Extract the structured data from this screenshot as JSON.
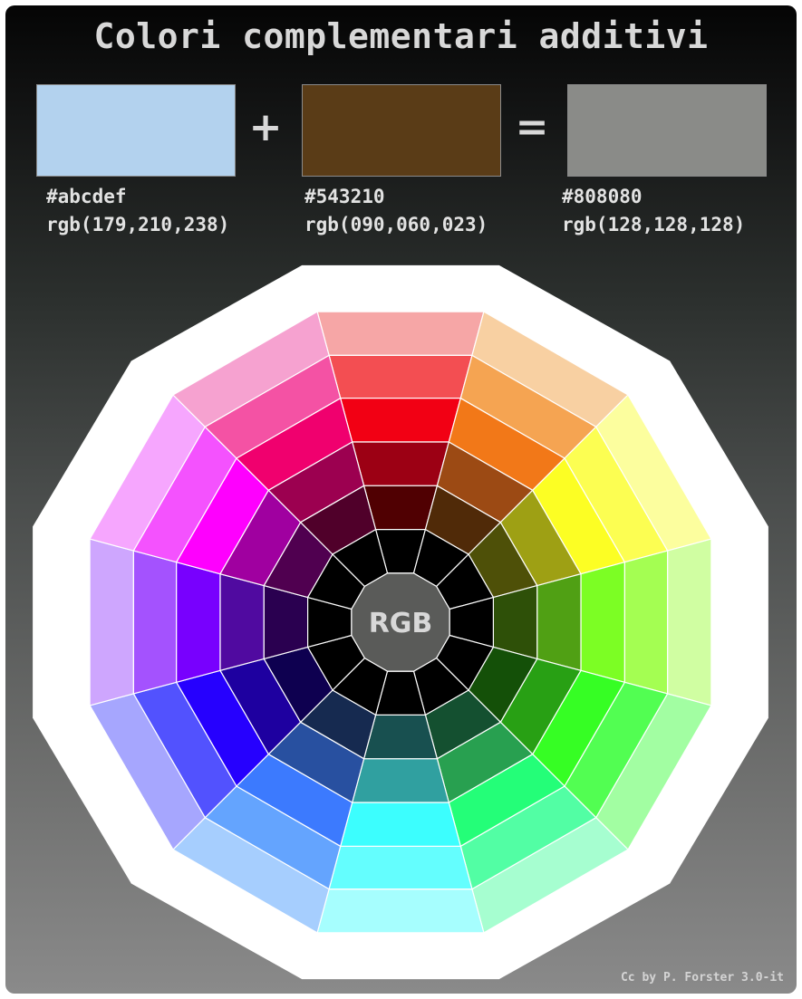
{
  "title": "Colori complementari additivi",
  "equation": {
    "operand_a": {
      "hex": "#abcdef",
      "rgb": "rgb(179,210,238)",
      "swatch": "#b3d2ee"
    },
    "plus": "+",
    "operand_b": {
      "hex": "#543210",
      "rgb": "rgb(090,060,023)",
      "swatch": "#5a3c17"
    },
    "equals": "=",
    "result": {
      "hex": "#808080",
      "rgb": "rgb(128,128,128)",
      "swatch": "#8a8b88"
    }
  },
  "wheel": {
    "center_label": "RGB",
    "center_color": "#5a5b59",
    "hues_clockwise_from_top": [
      "red",
      "orange",
      "yellow",
      "chartreuse",
      "green",
      "spring-green",
      "cyan",
      "azure",
      "blue",
      "violet",
      "magenta",
      "rose"
    ],
    "rings_outer_to_inner": [
      [
        "#f6a6a6",
        "#f8d0a2",
        "#fcfe9e",
        "#d0fea2",
        "#a2fea2",
        "#a6fed0",
        "#a6fefe",
        "#a6cefe",
        "#a6a6fe",
        "#cea6fe",
        "#f6a6fe",
        "#f6a2d0"
      ],
      [
        "#f34e52",
        "#f5a452",
        "#fcfe52",
        "#a4fe52",
        "#52fe52",
        "#52fea4",
        "#64fefe",
        "#64a4fe",
        "#5252fe",
        "#a452fe",
        "#f452fe",
        "#f452a4"
      ],
      [
        "#f20014",
        "#f27818",
        "#fcfe24",
        "#7cfe24",
        "#36fe24",
        "#24fe78",
        "#3cfefe",
        "#3c7afe",
        "#2600fe",
        "#7800fe",
        "#fe00fe",
        "#f0006e"
      ],
      [
        "#9c0014",
        "#9c4a14",
        "#9ea014",
        "#50a014",
        "#28a014",
        "#28a050",
        "#30a0a0",
        "#2850a0",
        "#1e00a0",
        "#500aa0",
        "#a000a0",
        "#9c0050"
      ],
      [
        "#500002",
        "#502a08",
        "#4e5008",
        "#2e5008",
        "#145008",
        "#145030",
        "#185050",
        "#162a50",
        "#0e0050",
        "#2a0050",
        "#500050",
        "#50002a"
      ],
      [
        "#000000",
        "#000000",
        "#000000",
        "#000000",
        "#000000",
        "#000000",
        "#000000",
        "#000000",
        "#000000",
        "#000000",
        "#000000",
        "#000000"
      ]
    ]
  },
  "credit": "Cc by P. Forster 3.0-it"
}
